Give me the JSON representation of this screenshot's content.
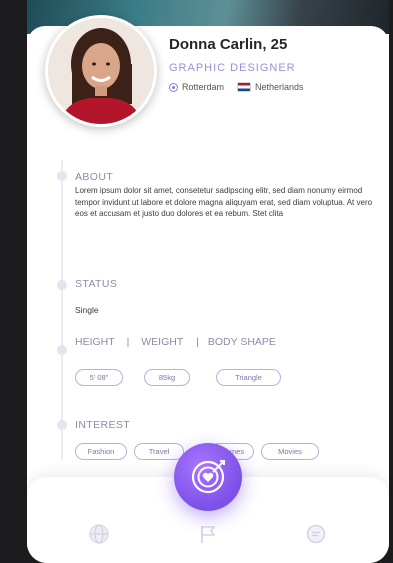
{
  "profile": {
    "name": "Donna Carlin, 25",
    "job_title": "GRAPHIC DESIGNER",
    "city": "Rotterdam",
    "country": "Netherlands"
  },
  "about": {
    "title": "ABOUT",
    "text": "Lorem ipsum dolor sit amet, consetetur sadipscing elitr, sed diam nonumy eirmod tempor invidunt ut labore et dolore magna aliquyam erat, sed diam voluptua. At vero eos et accusam et justo duo dolores et ea rebum. Stet clita"
  },
  "status": {
    "title": "STATUS",
    "value": "Single"
  },
  "body": {
    "height_label": "HEIGHT",
    "weight_label": "WEIGHT",
    "shape_label": "BODY SHAPE",
    "height_value": "5' 08\"",
    "weight_value": "85kg",
    "shape_value": "Triangle"
  },
  "interest": {
    "title": "INTEREST",
    "items": [
      "Fashion",
      "Travel",
      "Games",
      "Movies"
    ]
  },
  "icons": {
    "location": "map-pin-icon",
    "country": "netherlands-flag-icon",
    "fab": "target-heart-icon",
    "nav_left": "globe-icon",
    "nav_center": "flag-icon",
    "nav_right": "chat-icon"
  },
  "colors": {
    "accent": "#8a5cf0",
    "label": "#8f8aa8",
    "pill_border": "#b7b2dc"
  }
}
